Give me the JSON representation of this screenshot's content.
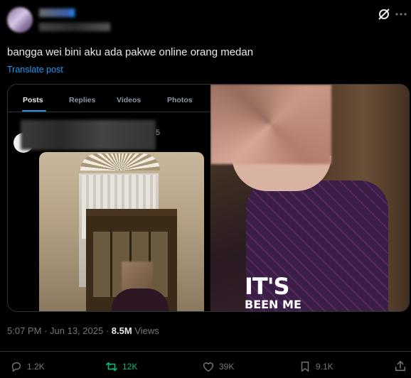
{
  "post": {
    "text": "bangga wei bini aku ada pakwe online orang medan",
    "translate_label": "Translate post",
    "time": "5:07 PM",
    "separator": "·",
    "date": "Jun 13, 2025",
    "views_count": "8.5M",
    "views_label": "Views"
  },
  "embedded": {
    "tabs": [
      {
        "label": "Posts"
      },
      {
        "label": "Replies"
      },
      {
        "label": "Videos"
      },
      {
        "label": "Photos"
      }
    ],
    "digit": "5",
    "caption_line1": "IT'S",
    "caption_line2": "BEEN ME"
  },
  "actions": {
    "replies": "1.2K",
    "reposts": "12K",
    "likes": "39K",
    "bookmarks": "9.1K"
  },
  "colors": {
    "accent": "#1d9bf0",
    "repost": "#00ba7c",
    "muted": "#71767b",
    "background": "#000000"
  },
  "icons": [
    "grok-icon",
    "more-icon",
    "reply-icon",
    "repost-icon",
    "like-icon",
    "bookmark-icon",
    "share-icon"
  ]
}
